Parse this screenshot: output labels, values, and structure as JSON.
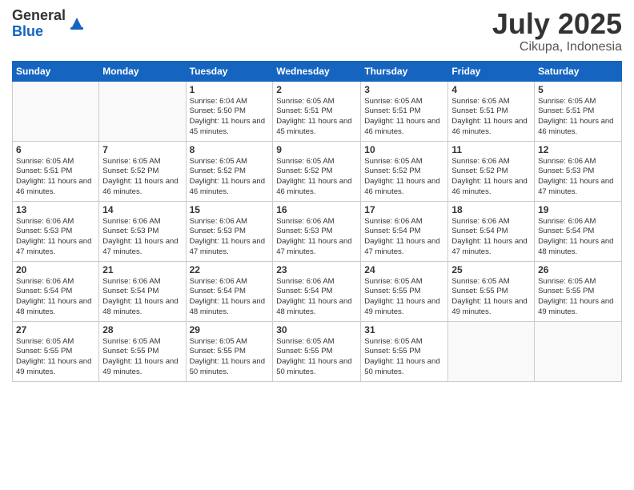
{
  "header": {
    "logo_general": "General",
    "logo_blue": "Blue",
    "month": "July 2025",
    "location": "Cikupa, Indonesia"
  },
  "days_of_week": [
    "Sunday",
    "Monday",
    "Tuesday",
    "Wednesday",
    "Thursday",
    "Friday",
    "Saturday"
  ],
  "weeks": [
    [
      {
        "day": "",
        "info": ""
      },
      {
        "day": "",
        "info": ""
      },
      {
        "day": "1",
        "info": "Sunrise: 6:04 AM\nSunset: 5:50 PM\nDaylight: 11 hours and 45 minutes."
      },
      {
        "day": "2",
        "info": "Sunrise: 6:05 AM\nSunset: 5:51 PM\nDaylight: 11 hours and 45 minutes."
      },
      {
        "day": "3",
        "info": "Sunrise: 6:05 AM\nSunset: 5:51 PM\nDaylight: 11 hours and 46 minutes."
      },
      {
        "day": "4",
        "info": "Sunrise: 6:05 AM\nSunset: 5:51 PM\nDaylight: 11 hours and 46 minutes."
      },
      {
        "day": "5",
        "info": "Sunrise: 6:05 AM\nSunset: 5:51 PM\nDaylight: 11 hours and 46 minutes."
      }
    ],
    [
      {
        "day": "6",
        "info": "Sunrise: 6:05 AM\nSunset: 5:51 PM\nDaylight: 11 hours and 46 minutes."
      },
      {
        "day": "7",
        "info": "Sunrise: 6:05 AM\nSunset: 5:52 PM\nDaylight: 11 hours and 46 minutes."
      },
      {
        "day": "8",
        "info": "Sunrise: 6:05 AM\nSunset: 5:52 PM\nDaylight: 11 hours and 46 minutes."
      },
      {
        "day": "9",
        "info": "Sunrise: 6:05 AM\nSunset: 5:52 PM\nDaylight: 11 hours and 46 minutes."
      },
      {
        "day": "10",
        "info": "Sunrise: 6:05 AM\nSunset: 5:52 PM\nDaylight: 11 hours and 46 minutes."
      },
      {
        "day": "11",
        "info": "Sunrise: 6:06 AM\nSunset: 5:52 PM\nDaylight: 11 hours and 46 minutes."
      },
      {
        "day": "12",
        "info": "Sunrise: 6:06 AM\nSunset: 5:53 PM\nDaylight: 11 hours and 47 minutes."
      }
    ],
    [
      {
        "day": "13",
        "info": "Sunrise: 6:06 AM\nSunset: 5:53 PM\nDaylight: 11 hours and 47 minutes."
      },
      {
        "day": "14",
        "info": "Sunrise: 6:06 AM\nSunset: 5:53 PM\nDaylight: 11 hours and 47 minutes."
      },
      {
        "day": "15",
        "info": "Sunrise: 6:06 AM\nSunset: 5:53 PM\nDaylight: 11 hours and 47 minutes."
      },
      {
        "day": "16",
        "info": "Sunrise: 6:06 AM\nSunset: 5:53 PM\nDaylight: 11 hours and 47 minutes."
      },
      {
        "day": "17",
        "info": "Sunrise: 6:06 AM\nSunset: 5:54 PM\nDaylight: 11 hours and 47 minutes."
      },
      {
        "day": "18",
        "info": "Sunrise: 6:06 AM\nSunset: 5:54 PM\nDaylight: 11 hours and 47 minutes."
      },
      {
        "day": "19",
        "info": "Sunrise: 6:06 AM\nSunset: 5:54 PM\nDaylight: 11 hours and 48 minutes."
      }
    ],
    [
      {
        "day": "20",
        "info": "Sunrise: 6:06 AM\nSunset: 5:54 PM\nDaylight: 11 hours and 48 minutes."
      },
      {
        "day": "21",
        "info": "Sunrise: 6:06 AM\nSunset: 5:54 PM\nDaylight: 11 hours and 48 minutes."
      },
      {
        "day": "22",
        "info": "Sunrise: 6:06 AM\nSunset: 5:54 PM\nDaylight: 11 hours and 48 minutes."
      },
      {
        "day": "23",
        "info": "Sunrise: 6:06 AM\nSunset: 5:54 PM\nDaylight: 11 hours and 48 minutes."
      },
      {
        "day": "24",
        "info": "Sunrise: 6:05 AM\nSunset: 5:55 PM\nDaylight: 11 hours and 49 minutes."
      },
      {
        "day": "25",
        "info": "Sunrise: 6:05 AM\nSunset: 5:55 PM\nDaylight: 11 hours and 49 minutes."
      },
      {
        "day": "26",
        "info": "Sunrise: 6:05 AM\nSunset: 5:55 PM\nDaylight: 11 hours and 49 minutes."
      }
    ],
    [
      {
        "day": "27",
        "info": "Sunrise: 6:05 AM\nSunset: 5:55 PM\nDaylight: 11 hours and 49 minutes."
      },
      {
        "day": "28",
        "info": "Sunrise: 6:05 AM\nSunset: 5:55 PM\nDaylight: 11 hours and 49 minutes."
      },
      {
        "day": "29",
        "info": "Sunrise: 6:05 AM\nSunset: 5:55 PM\nDaylight: 11 hours and 50 minutes."
      },
      {
        "day": "30",
        "info": "Sunrise: 6:05 AM\nSunset: 5:55 PM\nDaylight: 11 hours and 50 minutes."
      },
      {
        "day": "31",
        "info": "Sunrise: 6:05 AM\nSunset: 5:55 PM\nDaylight: 11 hours and 50 minutes."
      },
      {
        "day": "",
        "info": ""
      },
      {
        "day": "",
        "info": ""
      }
    ]
  ]
}
